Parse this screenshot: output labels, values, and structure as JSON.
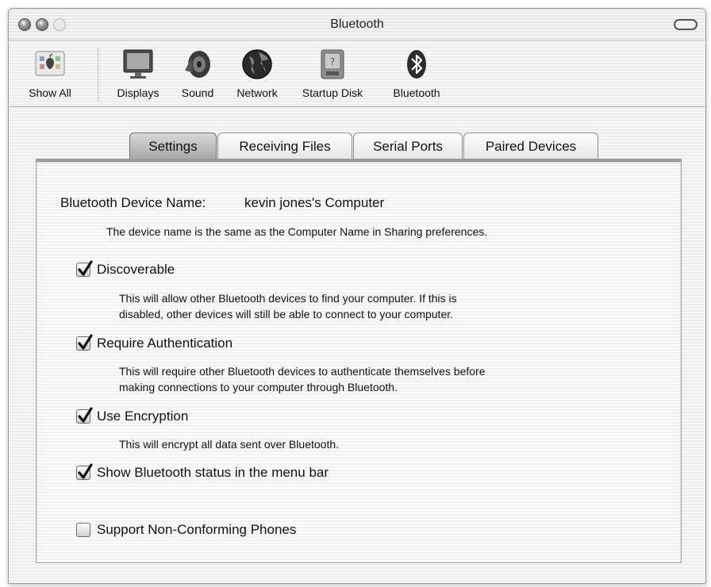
{
  "window": {
    "title": "Bluetooth"
  },
  "toolbar": {
    "items": [
      {
        "label": "Show All",
        "icon": "apple-grid-icon"
      },
      {
        "label": "Displays",
        "icon": "display-icon"
      },
      {
        "label": "Sound",
        "icon": "speaker-icon"
      },
      {
        "label": "Network",
        "icon": "globe-icon"
      },
      {
        "label": "Startup Disk",
        "icon": "disk-icon"
      },
      {
        "label": "Bluetooth",
        "icon": "bluetooth-icon"
      }
    ]
  },
  "tabs": [
    {
      "label": "Settings",
      "active": true
    },
    {
      "label": "Receiving Files",
      "active": false
    },
    {
      "label": "Serial Ports",
      "active": false
    },
    {
      "label": "Paired Devices",
      "active": false
    }
  ],
  "settings": {
    "device_name_label": "Bluetooth Device Name:",
    "device_name_value": "kevin jones's Computer",
    "device_name_note": "The device name is the same as the Computer Name in Sharing preferences.",
    "options": [
      {
        "label": "Discoverable",
        "checked": true,
        "description": [
          "This will allow other Bluetooth devices to find your computer.  If this is",
          "disabled, other devices will still be able to connect to your computer."
        ]
      },
      {
        "label": "Require Authentication",
        "checked": true,
        "description": [
          "This will require other Bluetooth devices to authenticate themselves before",
          "making connections to your computer through Bluetooth."
        ]
      },
      {
        "label": "Use Encryption",
        "checked": true,
        "description": [
          "This will encrypt all data sent over Bluetooth."
        ]
      },
      {
        "label": "Show Bluetooth status in the menu bar",
        "checked": true,
        "description": []
      },
      {
        "label": "Support Non-Conforming Phones",
        "checked": false,
        "description": []
      }
    ]
  }
}
